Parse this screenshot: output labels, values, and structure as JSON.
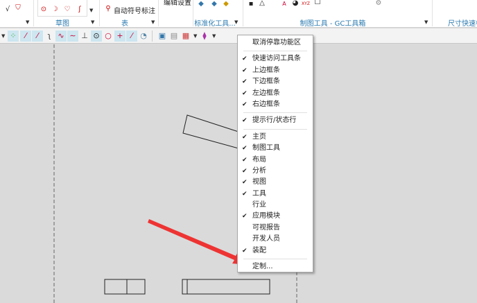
{
  "ribbon": {
    "groups": [
      {
        "label": "草图"
      },
      {
        "label": "表"
      },
      {
        "label": "标准化工具..."
      },
      {
        "label": "制图工具 - GC工具箱"
      },
      {
        "label": "尺寸快速标"
      }
    ],
    "auto_symbol_label": "自动符号标注",
    "edit_settings_label": "编辑设置"
  },
  "context_menu": {
    "items": [
      {
        "label": "取消停靠功能区",
        "checked": false
      },
      {
        "sep": true
      },
      {
        "label": "快速访问工具条",
        "checked": true
      },
      {
        "label": "上边框条",
        "checked": true
      },
      {
        "label": "下边框条",
        "checked": true
      },
      {
        "label": "左边框条",
        "checked": true
      },
      {
        "label": "右边框条",
        "checked": true
      },
      {
        "sep": true
      },
      {
        "label": "提示行/状态行",
        "checked": true
      },
      {
        "sep": true
      },
      {
        "label": "主页",
        "checked": true
      },
      {
        "label": "制图工具",
        "checked": true
      },
      {
        "label": "布局",
        "checked": true
      },
      {
        "label": "分析",
        "checked": true
      },
      {
        "label": "视图",
        "checked": true
      },
      {
        "label": "工具",
        "checked": true
      },
      {
        "label": "行业",
        "checked": false
      },
      {
        "label": "应用模块",
        "checked": true
      },
      {
        "label": "可视报告",
        "checked": false
      },
      {
        "label": "开发人员",
        "checked": false
      },
      {
        "label": "装配",
        "checked": true
      },
      {
        "sep": true
      },
      {
        "label": "定制...",
        "checked": false
      }
    ]
  },
  "colors": {
    "accent": "#2a7ab0",
    "arrow": "#ee3333",
    "canvas": "#dadada"
  }
}
